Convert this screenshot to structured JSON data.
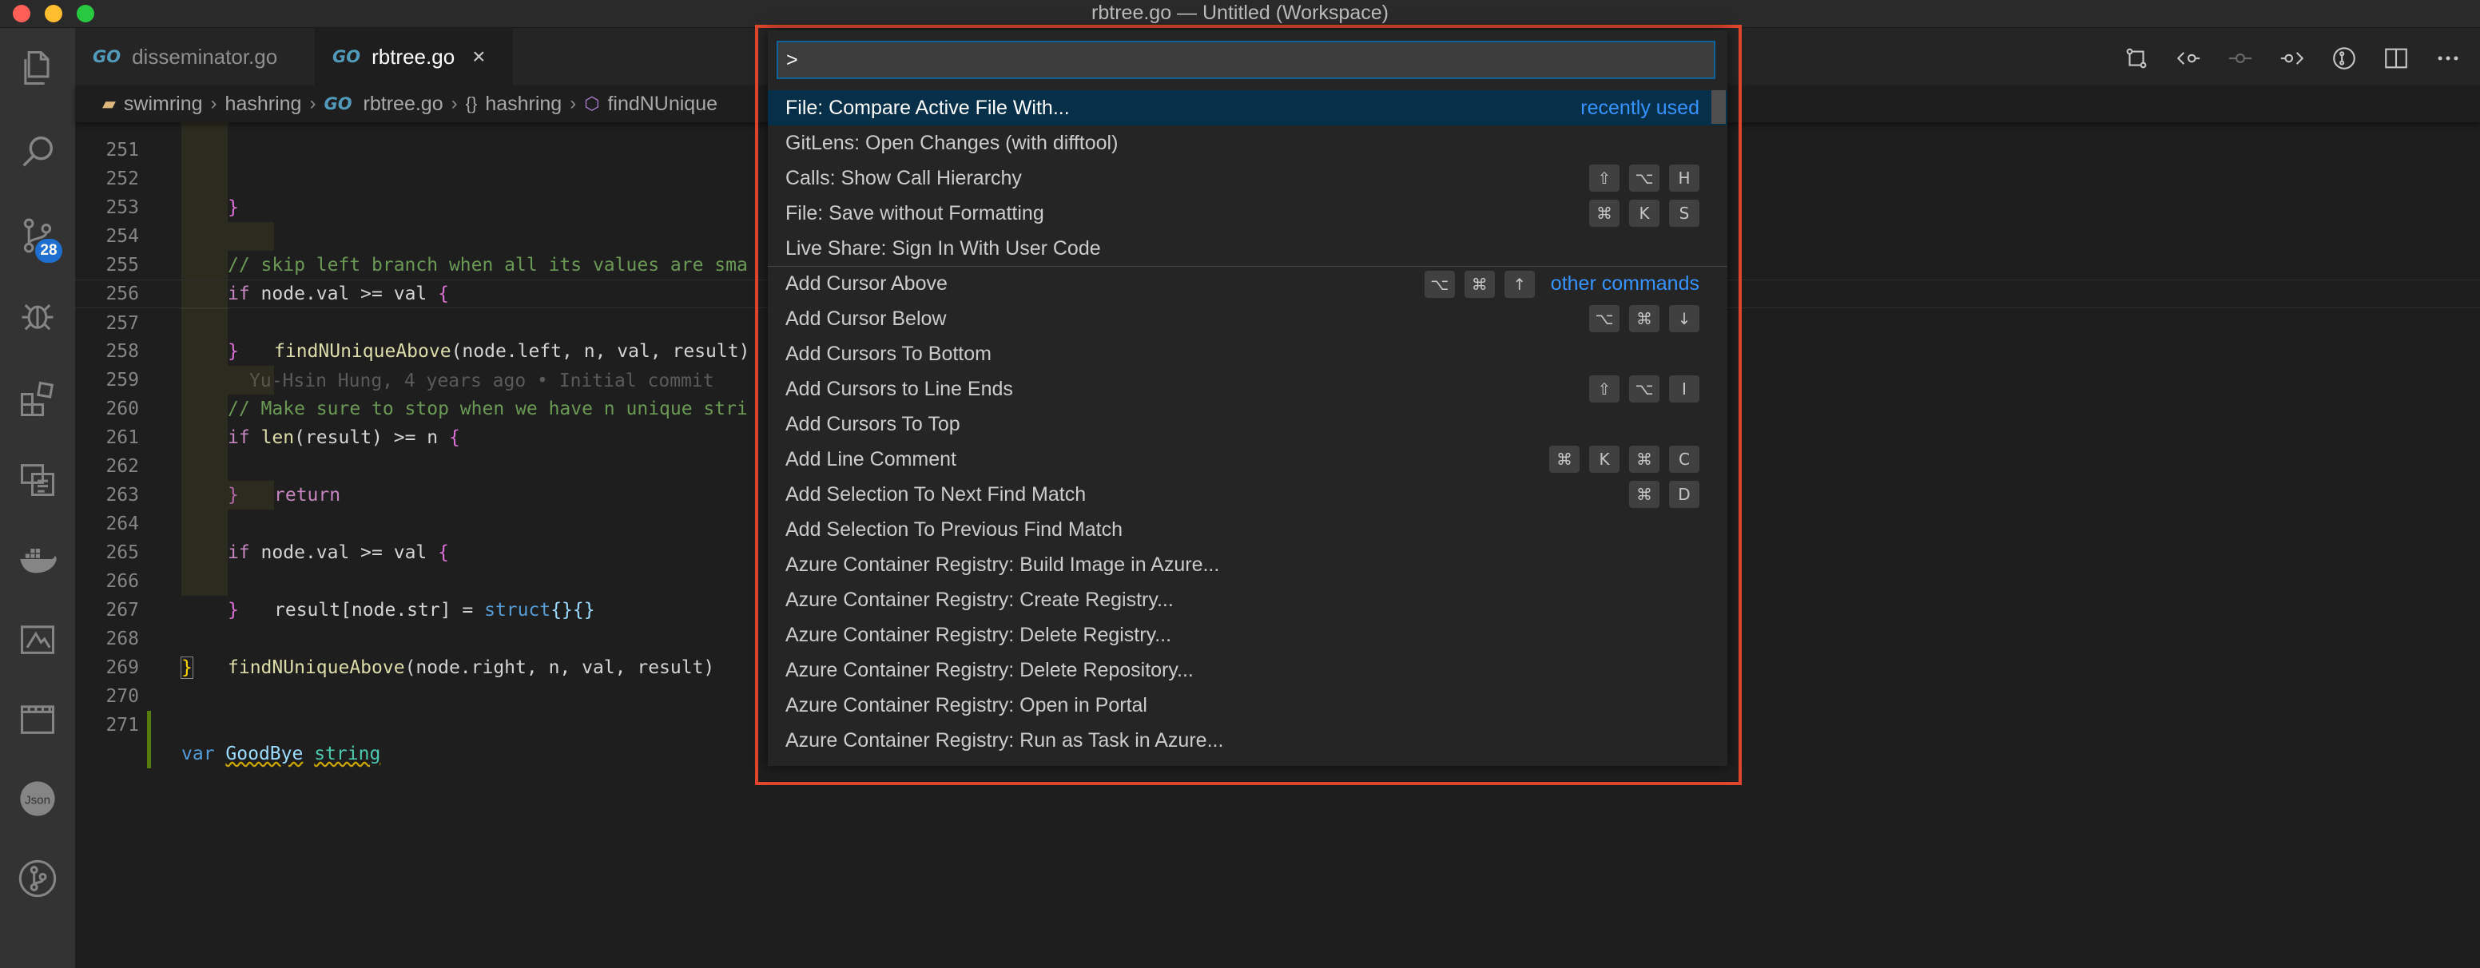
{
  "window": {
    "title": "rbtree.go — Untitled (Workspace)"
  },
  "activity_bar": {
    "scm_badge": "28",
    "json_label": "Json"
  },
  "tabs": [
    {
      "label": "disseminator.go",
      "icon": "GO",
      "active": false
    },
    {
      "label": "rbtree.go",
      "icon": "GO",
      "active": true,
      "close": "×"
    }
  ],
  "breadcrumbs": [
    "swimring",
    "hashring",
    "rbtree.go",
    "hashring",
    "findNUnique"
  ],
  "breadcrumb_icons": {
    "file": "GO",
    "namespace": "{}"
  },
  "code": {
    "line_numbers": [
      "251",
      "252",
      "253",
      "254",
      "255",
      "256",
      "257",
      "258",
      "259",
      "260",
      "261",
      "262",
      "263",
      "264",
      "265",
      "266",
      "267",
      "268",
      "269",
      "270",
      "271"
    ],
    "l253_comment": "// skip left branch when all its values are sma",
    "l254_if": "if",
    "l254_expr": " node.val >= val ",
    "l254_brace": "{",
    "l255_fn": "findNUniqueAbove",
    "l255_args": "(node.left, n, val, result)",
    "l256_brace": "}",
    "l257_blame": "Yu-Hsin Hung, 4 years ago • Initial commit",
    "l258_comment": "// Make sure to stop when we have n unique stri",
    "l259_if": "if",
    "l259_fn": "len",
    "l259_expr": "(result) >= n ",
    "l259_brace": "{",
    "l260_return": "return",
    "l261_brace": "}",
    "l263_if": "if",
    "l263_expr": " node.val >= val ",
    "l263_brace": "{",
    "l264_a": "result[node.str] = ",
    "l264_kw": "struct",
    "l264_b": "{}{}",
    "l265_brace": "}",
    "l267_fn": "findNUniqueAbove",
    "l267_args": "(node.right, n, val, result)",
    "l268_brace": "}",
    "l270_kw": "var",
    "l270_name": "GoodBye",
    "l270_type": "string",
    "l251_brace": "}"
  },
  "palette": {
    "input_value": ">",
    "commands": [
      {
        "label": "File: Compare Active File With...",
        "keys": [],
        "hint": "recently used",
        "selected": true
      },
      {
        "label": "GitLens: Open Changes (with difftool)",
        "keys": []
      },
      {
        "label": "Calls: Show Call Hierarchy",
        "keys": [
          "⇧",
          "⌥",
          "H"
        ]
      },
      {
        "label": "File: Save without Formatting",
        "keys": [
          "⌘",
          "K",
          "S"
        ]
      },
      {
        "label": "Live Share: Sign In With User Code",
        "keys": []
      },
      {
        "label": "Add Cursor Above",
        "keys": [
          "⌥",
          "⌘",
          "↑"
        ],
        "hint": "other commands",
        "separator": true
      },
      {
        "label": "Add Cursor Below",
        "keys": [
          "⌥",
          "⌘",
          "↓"
        ]
      },
      {
        "label": "Add Cursors To Bottom",
        "keys": []
      },
      {
        "label": "Add Cursors to Line Ends",
        "keys": [
          "⇧",
          "⌥",
          "I"
        ]
      },
      {
        "label": "Add Cursors To Top",
        "keys": []
      },
      {
        "label": "Add Line Comment",
        "keys": [
          "⌘",
          "K",
          "⌘",
          "C"
        ]
      },
      {
        "label": "Add Selection To Next Find Match",
        "keys": [
          "⌘",
          "D"
        ]
      },
      {
        "label": "Add Selection To Previous Find Match",
        "keys": []
      },
      {
        "label": "Azure Container Registry: Build Image in Azure...",
        "keys": []
      },
      {
        "label": "Azure Container Registry: Create Registry...",
        "keys": []
      },
      {
        "label": "Azure Container Registry: Delete Registry...",
        "keys": []
      },
      {
        "label": "Azure Container Registry: Delete Repository...",
        "keys": []
      },
      {
        "label": "Azure Container Registry: Open in Portal",
        "keys": []
      },
      {
        "label": "Azure Container Registry: Run as Task in Azure...",
        "keys": []
      }
    ]
  },
  "colors": {
    "highlight_border": "#e0462d",
    "selected_row": "#062f4a",
    "accent": "#3794ff",
    "badge": "#1f6fd0"
  }
}
